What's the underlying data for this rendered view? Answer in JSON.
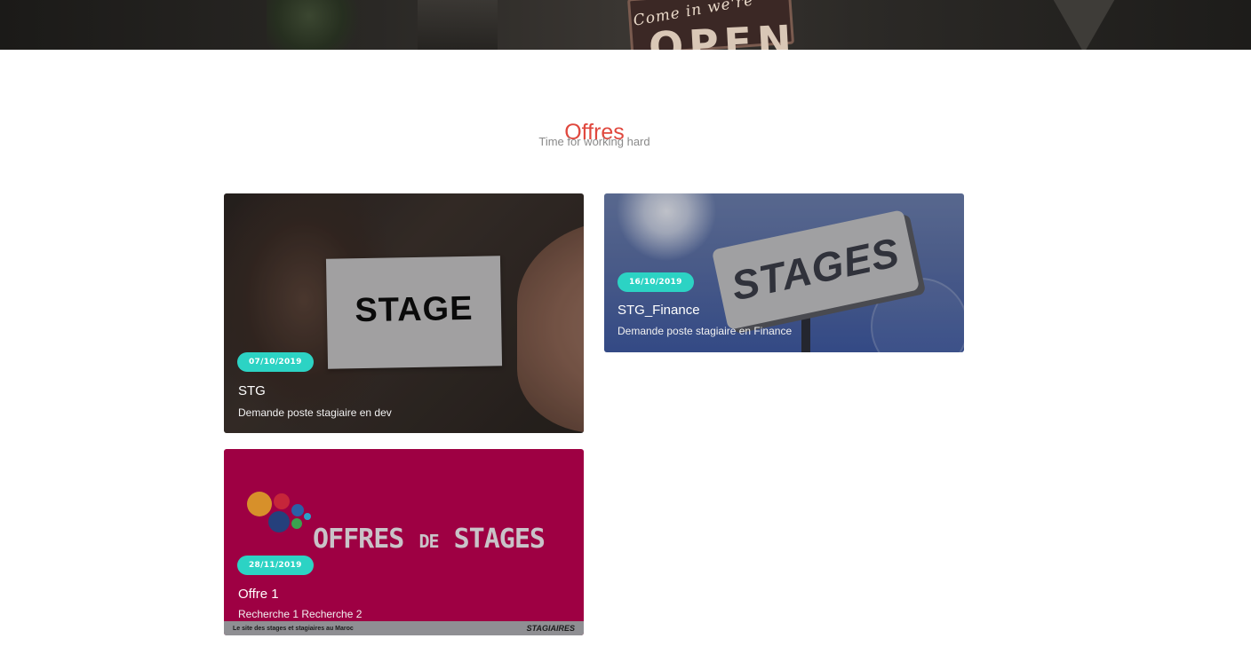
{
  "hero": {
    "sign_script": "Come in we're",
    "sign_word": "OPEN"
  },
  "section": {
    "title": "Offres",
    "subtitle": "Time for working hard"
  },
  "cards": [
    {
      "date": "07/10/2019",
      "title": "STG",
      "description": "Demande poste stagiaire en dev",
      "image_text": "STAGE"
    },
    {
      "date": "16/10/2019",
      "title": "STG_Finance",
      "description": "Demande poste stagiaire en Finance",
      "image_text": "STAGES"
    },
    {
      "date": "28/11/2019",
      "title": "Offre 1",
      "description": "Recherche 1 Recherche 2",
      "image_text": {
        "word1": "OFFRES",
        "word2": "DE",
        "word3": "STAGES"
      },
      "footer_left": "Le site des stages et stagiaires au Maroc",
      "footer_right": "STAGIAIRES"
    }
  ],
  "colors": {
    "accent_title": "#e0483e",
    "badge": "#2cd3c4",
    "offre_bg": "#9e0043"
  }
}
